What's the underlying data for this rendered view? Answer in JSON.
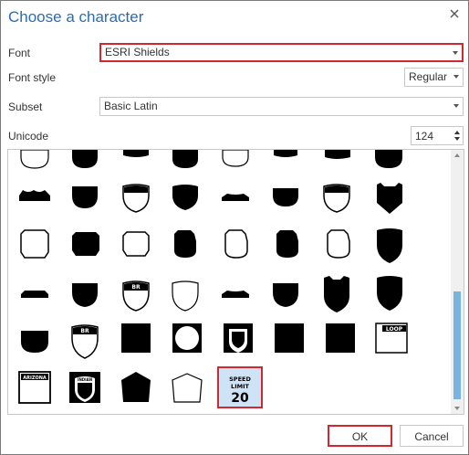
{
  "dialog": {
    "title": "Choose a character",
    "font_label": "Font",
    "font_value": "ESRI Shields",
    "font_style_label": "Font style",
    "font_style_value": "Regular",
    "subset_label": "Subset",
    "subset_value": "Basic Latin",
    "unicode_label": "Unicode",
    "unicode_value": "124",
    "ok_label": "OK",
    "cancel_label": "Cancel",
    "highlight_color": "#d3262e",
    "accent_color": "#2b6cb0"
  },
  "glyphs": {
    "row5": {
      "loop_label": "LOOP",
      "arizona_label": "ARIZONA",
      "indian_label": "INDIAN",
      "br_label": "BR"
    },
    "selected_glyph": {
      "line1": "SPEED",
      "line2": "LIMIT",
      "line3": "20"
    }
  }
}
